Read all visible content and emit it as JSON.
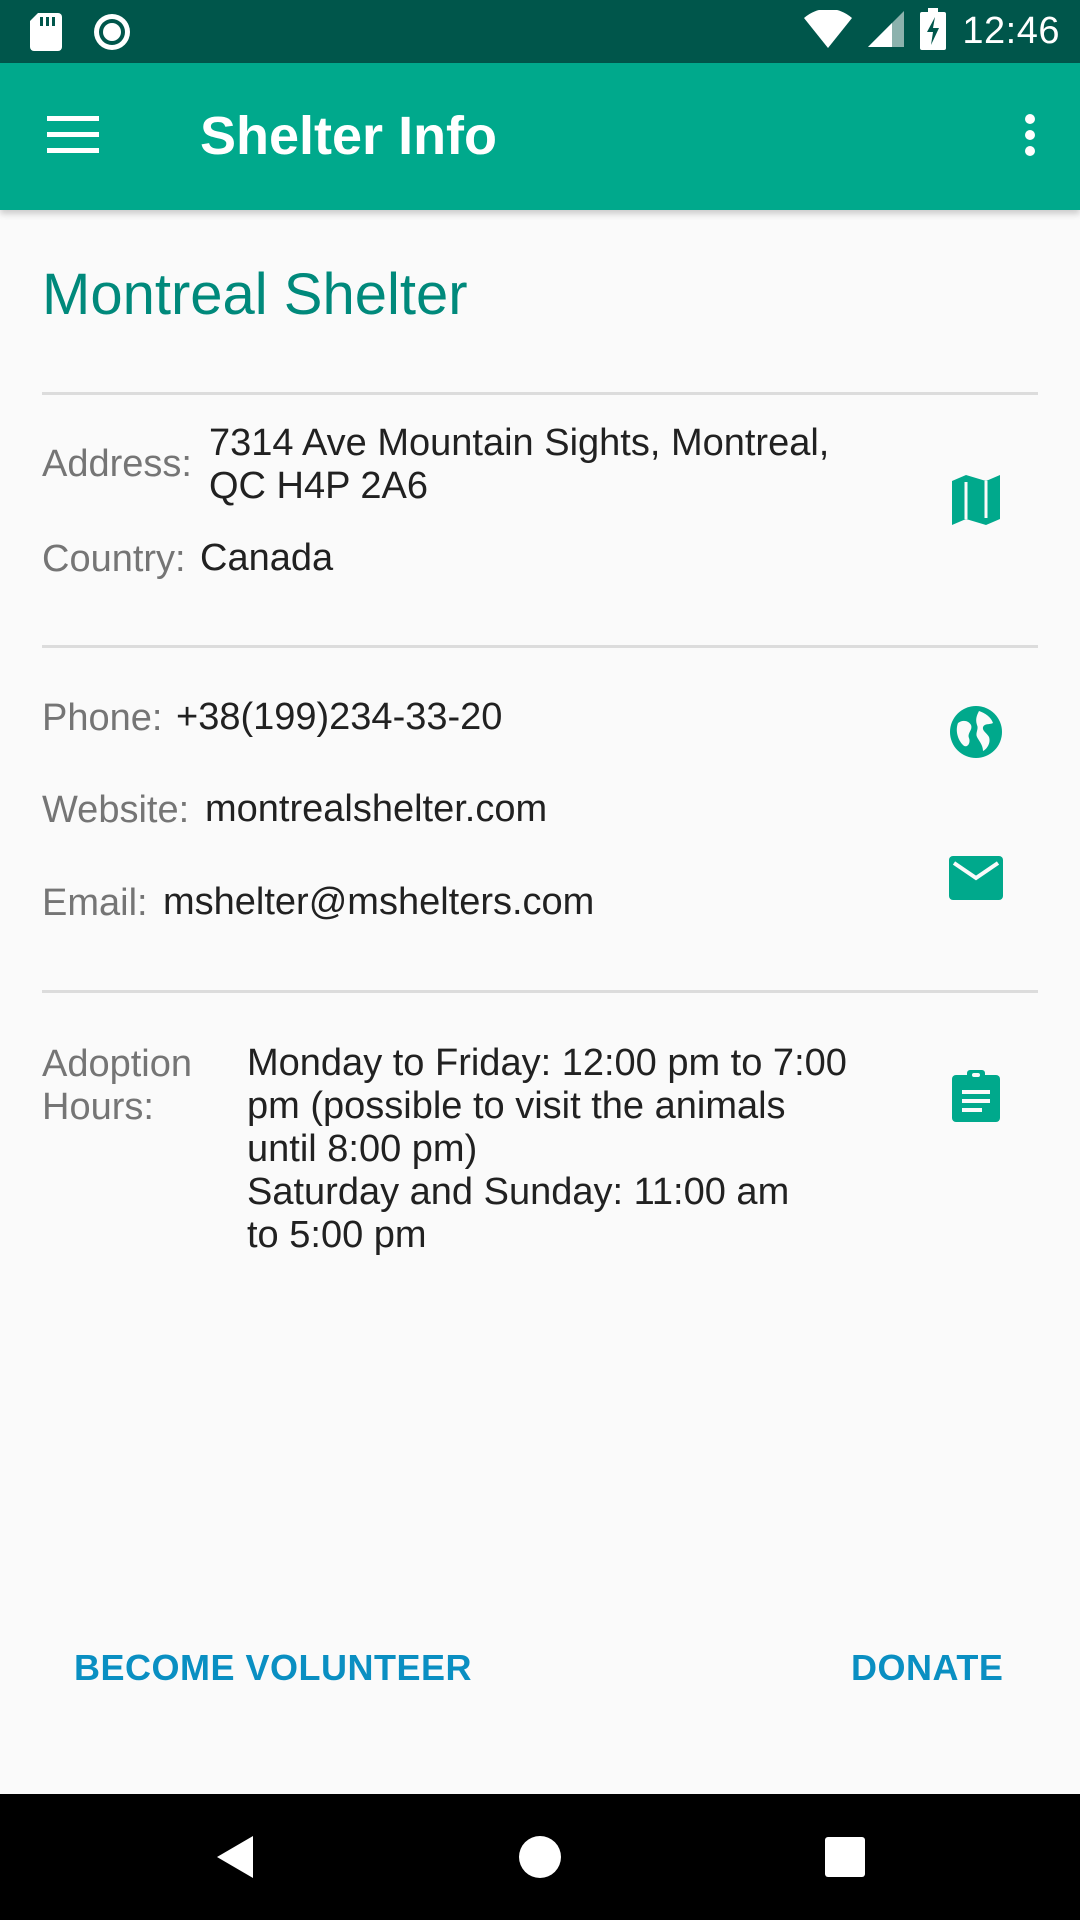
{
  "status_bar": {
    "time": "12:46",
    "icons": [
      "sd-card-icon",
      "record-icon",
      "wifi-icon",
      "signal-icon",
      "battery-charging-icon"
    ]
  },
  "app_bar": {
    "title": "Shelter Info",
    "menu_icon": "hamburger-menu-icon",
    "overflow_icon": "more-vert-icon",
    "background": "#00a98c"
  },
  "shelter": {
    "name": "Montreal Shelter",
    "address_label": "Address:",
    "address_line1": "7314 Ave Mountain Sights, Montreal,",
    "address_line2": "QC H4P 2A6",
    "country_label": "Country:",
    "country": "Canada",
    "phone_label": "Phone:",
    "phone": "+38(199)234-33-20",
    "website_label": "Website:",
    "website": "montrealshelter.com",
    "email_label": "Email:",
    "email": "mshelter@mshelters.com",
    "hours_label_line1": "Adoption",
    "hours_label_line2": "Hours:",
    "hours_lines": [
      "Monday to Friday: 12:00 pm to 7:00",
      "pm (possible to visit the animals",
      "until 8:00 pm)",
      "Saturday and Sunday: 11:00 am",
      "to 5:00 pm"
    ]
  },
  "actions": {
    "volunteer": "BECOME VOLUNTEER",
    "donate": "DONATE"
  },
  "colors": {
    "accent": "#00897b",
    "icon": "#00a98c",
    "button_text": "#0a8fc2",
    "status_bar": "#00564b"
  }
}
